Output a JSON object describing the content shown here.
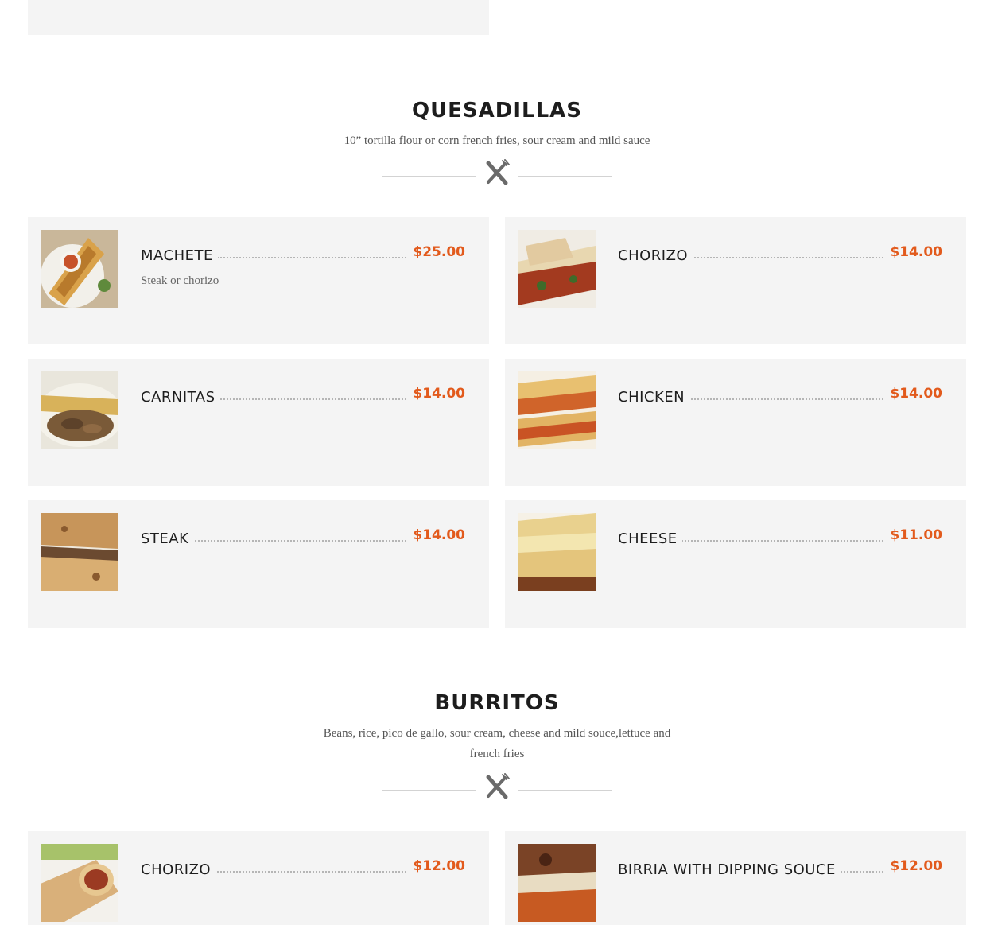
{
  "sections": [
    {
      "title": "QUESADILLAS",
      "description": "10” tortilla flour or corn french fries, sour cream and mild sauce",
      "items": [
        {
          "name": "MACHETE",
          "price": "$25.00",
          "description": "Steak or chorizo",
          "image": "quesadilla-machete-photo"
        },
        {
          "name": "CHORIZO",
          "price": "$14.00",
          "description": "",
          "image": "quesadilla-chorizo-photo"
        },
        {
          "name": "CARNITAS",
          "price": "$14.00",
          "description": "",
          "image": "quesadilla-carnitas-photo"
        },
        {
          "name": "CHICKEN",
          "price": "$14.00",
          "description": "",
          "image": "quesadilla-chicken-photo"
        },
        {
          "name": "STEAK",
          "price": "$14.00",
          "description": "",
          "image": "quesadilla-steak-photo"
        },
        {
          "name": "CHEESE",
          "price": "$11.00",
          "description": "",
          "image": "quesadilla-cheese-photo"
        }
      ]
    },
    {
      "title": "BURRITOS",
      "description": "Beans, rice, pico de gallo, sour cream, cheese and mild souce,lettuce and french fries",
      "items": [
        {
          "name": "CHORIZO",
          "price": "$12.00",
          "description": "",
          "image": "burrito-chorizo-photo"
        },
        {
          "name": "BIRRIA WITH DIPPING SOUCE",
          "price": "$12.00",
          "description": "",
          "image": "burrito-birria-photo"
        }
      ]
    }
  ],
  "colors": {
    "accent_price": "#e25a1c",
    "card_bg": "#f4f4f4",
    "title": "#1d1d1d"
  },
  "icons": {
    "divider": "fork-knife-icon"
  }
}
